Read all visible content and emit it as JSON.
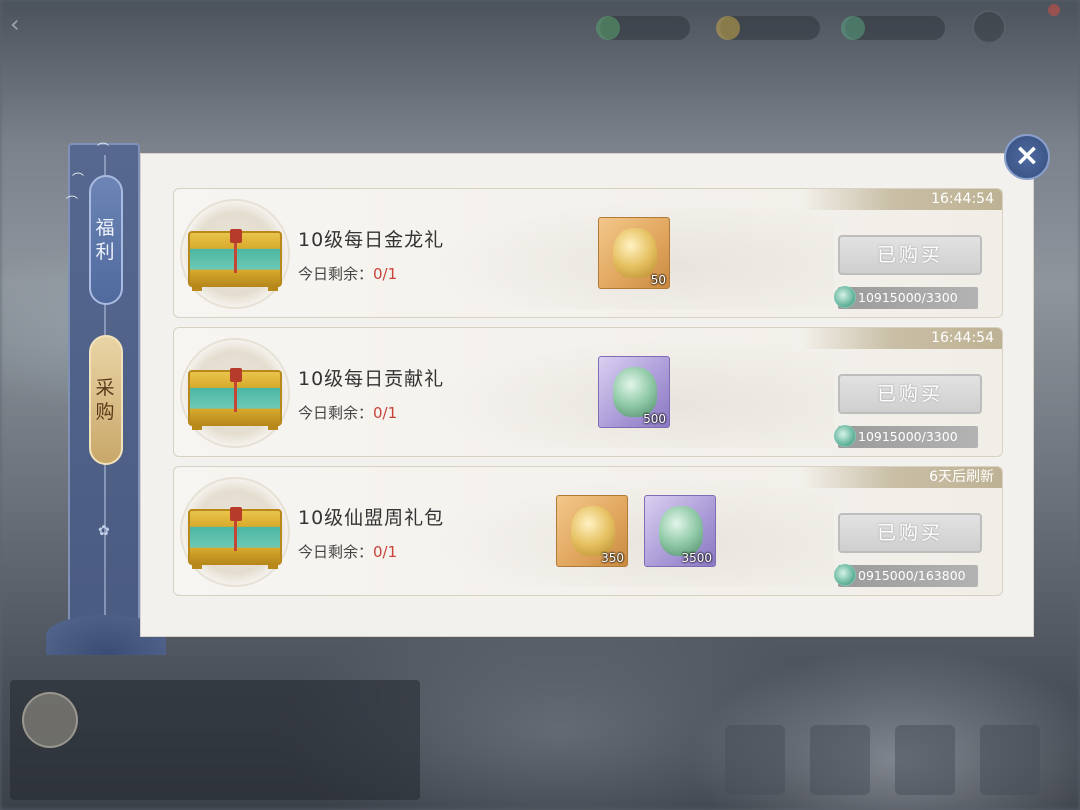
{
  "sidebar": {
    "tabs": [
      {
        "chars": [
          "福",
          "利"
        ],
        "active": false
      },
      {
        "chars": [
          "采",
          "购"
        ],
        "active": true
      }
    ]
  },
  "offers": [
    {
      "timer": "16:44:54",
      "title": "10级每日金龙礼",
      "remain_label": "今日剩余：",
      "remain_value": "0/1",
      "items": [
        {
          "icon": "golden-dragon-token",
          "rarity": "gold",
          "qty": "50"
        }
      ],
      "button": "已购买",
      "price": "10915000/3300"
    },
    {
      "timer": "16:44:54",
      "title": "10级每日贡献礼",
      "remain_label": "今日剩余：",
      "remain_value": "0/1",
      "items": [
        {
          "icon": "jade-contribution-token",
          "rarity": "purple",
          "qty": "500"
        }
      ],
      "button": "已购买",
      "price": "10915000/3300"
    },
    {
      "timer": "6天后刷新",
      "title": "10级仙盟周礼包",
      "remain_label": "今日剩余：",
      "remain_value": "0/1",
      "items": [
        {
          "icon": "golden-dragon-token",
          "rarity": "gold",
          "qty": "350"
        },
        {
          "icon": "jade-contribution-token",
          "rarity": "purple",
          "qty": "3500"
        }
      ],
      "button": "已购买",
      "price": "0915000/163800"
    }
  ],
  "close_icon": "×",
  "colors": {
    "panel": "#f3f1ed",
    "sidebar": "#4a5b82",
    "remain_value": "#c9423a",
    "timer_bar": "#c9bfa6"
  }
}
